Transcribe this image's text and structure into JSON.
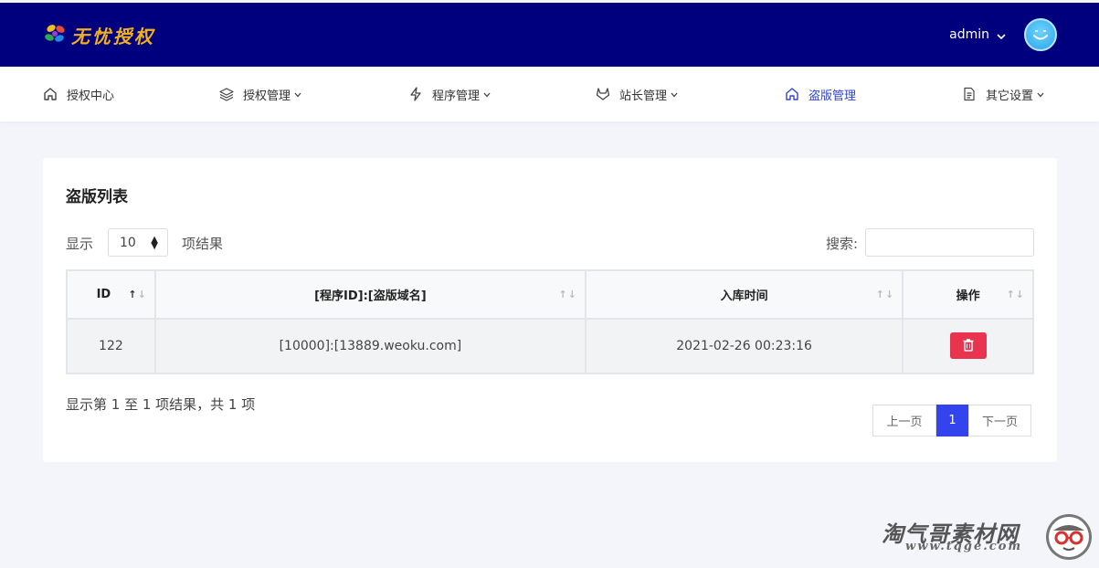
{
  "brand": {
    "name": "无忧授权"
  },
  "user": {
    "name": "admin"
  },
  "nav": [
    {
      "label": "授权中心",
      "icon": "home-icon"
    },
    {
      "label": "授权管理",
      "icon": "layers-icon",
      "dropdown": true
    },
    {
      "label": "程序管理",
      "icon": "bolt-icon",
      "dropdown": true
    },
    {
      "label": "站长管理",
      "icon": "gitlab-icon",
      "dropdown": true
    },
    {
      "label": "盗版管理",
      "icon": "home-icon",
      "active": true
    },
    {
      "label": "其它设置",
      "icon": "file-icon",
      "dropdown": true
    }
  ],
  "page": {
    "title": "盗版列表"
  },
  "length_menu": {
    "prefix": "显示",
    "value": "10",
    "suffix": "项结果"
  },
  "search": {
    "label": "搜索:",
    "value": ""
  },
  "table": {
    "headers": [
      "ID",
      "[程序ID]:[盗版域名]",
      "入库时间",
      "操作"
    ],
    "rows": [
      {
        "id": "122",
        "domain": "[10000]:[13889.weoku.com]",
        "time": "2021-02-26 00:23:16",
        "action_icon": "trash-icon"
      }
    ]
  },
  "table_info": "显示第 1 至 1 项结果，共 1 项",
  "pagination": {
    "prev": "上一页",
    "current": "1",
    "next": "下一页"
  },
  "watermark": {
    "title": "淘气哥素材网",
    "url": "www.tqge.com"
  },
  "colors": {
    "header_bg": "#00007e",
    "active_nav": "#3344cc",
    "danger": "#e8344f",
    "page_active": "#3344ee",
    "page_bg": "#f3f5fb"
  }
}
